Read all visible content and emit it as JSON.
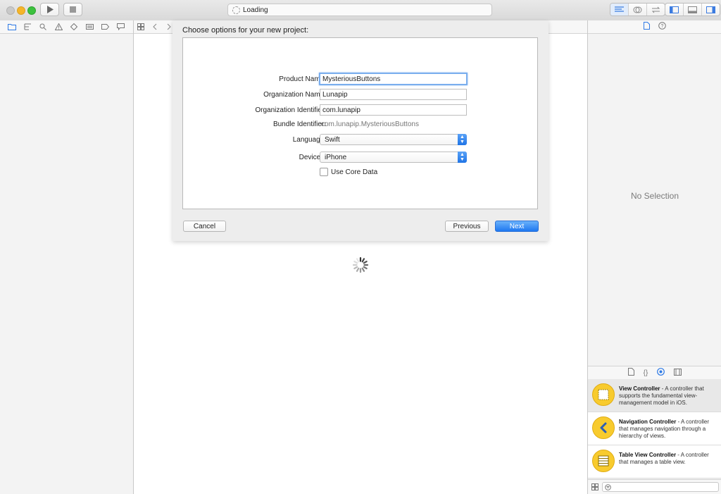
{
  "toolbar": {
    "status_text": "Loading"
  },
  "sheet": {
    "title": "Choose options for your new project:",
    "fields": {
      "product_name_label": "Product Name:",
      "product_name_value": "MysteriousButtons",
      "organization_name_label": "Organization Name:",
      "organization_name_value": "Lunapip",
      "organization_identifier_label": "Organization Identifier:",
      "organization_identifier_value": "com.lunapip",
      "bundle_identifier_label": "Bundle Identifier:",
      "bundle_identifier_value": "com.lunapip.MysteriousButtons",
      "language_label": "Language:",
      "language_value": "Swift",
      "devices_label": "Devices:",
      "devices_value": "iPhone",
      "core_data_label": "Use Core Data",
      "core_data_checked": false
    },
    "buttons": {
      "cancel": "Cancel",
      "previous": "Previous",
      "next": "Next"
    }
  },
  "inspector": {
    "no_selection": "No Selection"
  },
  "library": {
    "items": [
      {
        "title": "View Controller",
        "description": " - A controller that supports the fundamental view-management model in iOS.",
        "icon": "view-controller-icon"
      },
      {
        "title": "Navigation Controller",
        "description": " - A controller that manages navigation through a hierarchy of views.",
        "icon": "navigation-controller-icon"
      },
      {
        "title": "Table View Controller",
        "description": " - A controller that manages a table view.",
        "icon": "table-view-controller-icon"
      }
    ]
  },
  "colors": {
    "accent": "#1f78f1",
    "library_icon": "#f8cb2e"
  }
}
